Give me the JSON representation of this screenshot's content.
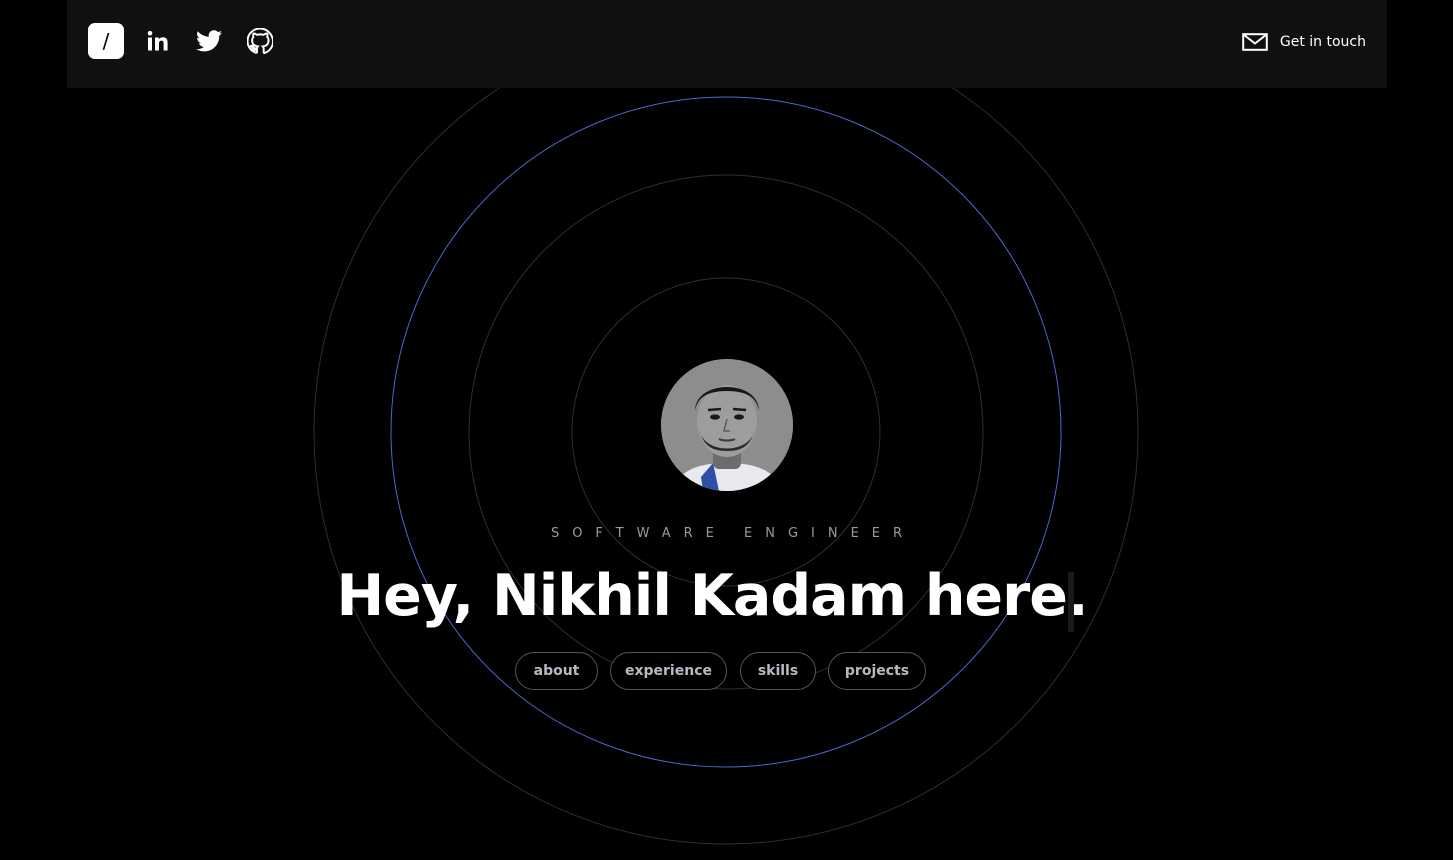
{
  "header": {
    "logo_glyph": "/",
    "social": [
      {
        "name": "LinkedIn",
        "icon": "linkedin-icon"
      },
      {
        "name": "Twitter",
        "icon": "twitter-icon"
      },
      {
        "name": "GitHub",
        "icon": "github-icon"
      }
    ],
    "contact_label": "Get in touch",
    "contact_icon": "mail-icon"
  },
  "hero": {
    "avatar_icon": "profile-avatar",
    "role": "SOFTWARE ENGINEER",
    "headline": "Hey, Nikhil Kadam here.",
    "nav": [
      {
        "label": "about"
      },
      {
        "label": "experience"
      },
      {
        "label": "skills"
      },
      {
        "label": "projects"
      }
    ]
  },
  "colors": {
    "background": "#000000",
    "header_bg": "#101010",
    "ring": "#3a3a3a",
    "accent_ring": "#4a68c8",
    "text": "#ffffff",
    "muted": "#9a9a9a"
  }
}
